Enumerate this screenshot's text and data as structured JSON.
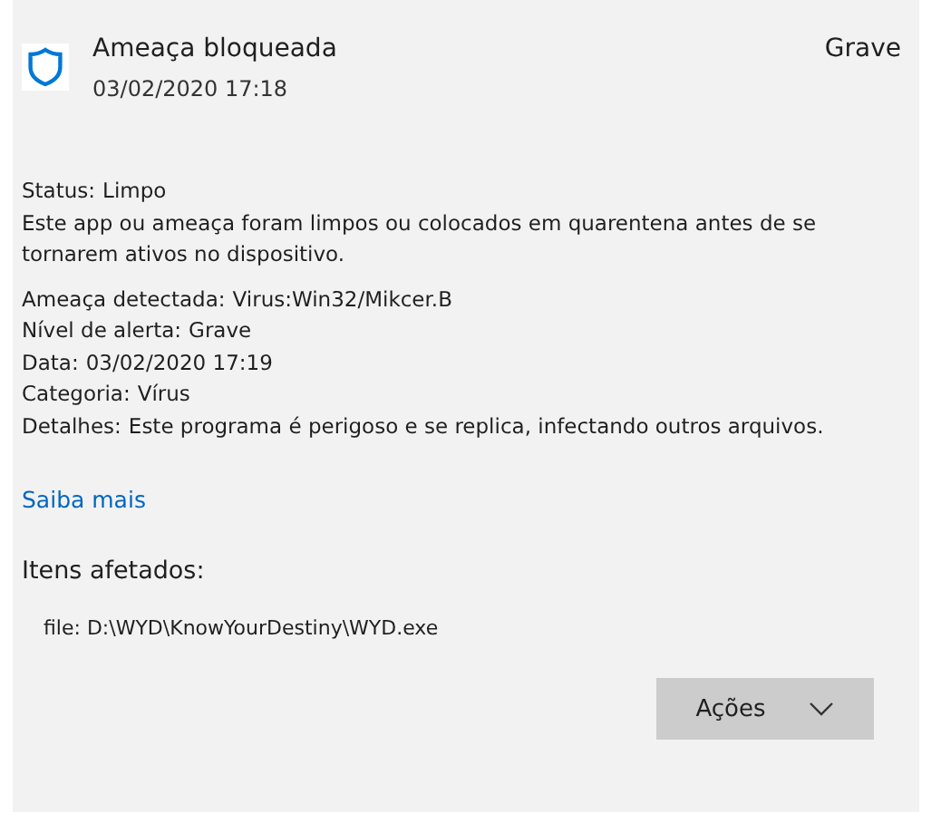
{
  "header": {
    "title": "Ameaça bloqueada",
    "date": "03/02/2020 17:18",
    "severity": "Grave"
  },
  "status": {
    "label": "Status:",
    "value": "Limpo"
  },
  "description": "Este app ou ameaça foram limpos ou colocados em quarentena antes de se tornarem ativos no dispositivo.",
  "details": [
    {
      "label": "Ameaça detectada:",
      "value": "Virus:Win32/Mikcer.B"
    },
    {
      "label": "Nível de alerta:",
      "value": "Grave"
    },
    {
      "label": "Data:",
      "value": "03/02/2020 17:19"
    },
    {
      "label": "Categoria:",
      "value": "Vírus"
    },
    {
      "label": "Detalhes:",
      "value": "Este programa é perigoso e se replica, infectando outros arquivos."
    }
  ],
  "link": "Saiba mais",
  "affected": {
    "heading": "Itens afetados:",
    "items": [
      "file: D:\\WYD\\KnowYourDestiny\\WYD.exe"
    ]
  },
  "actions_button": "Ações"
}
